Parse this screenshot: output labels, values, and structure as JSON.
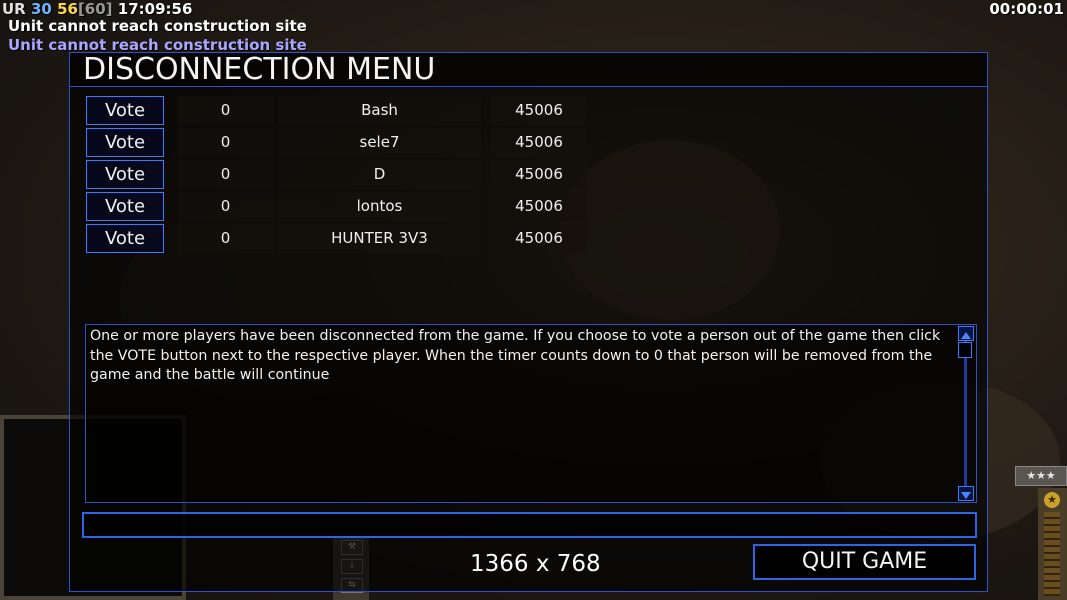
{
  "hud": {
    "ur_label": "UR",
    "stat1": "30",
    "stat2": "56",
    "stat3": "[60]",
    "clock": "17:09:56",
    "timer": "00:00:01"
  },
  "messages": [
    "Unit cannot reach construction site",
    "Unit cannot reach construction site"
  ],
  "dialog": {
    "title": "DISCONNECTION MENU",
    "vote_label": "Vote",
    "players": [
      {
        "count": "0",
        "name": "Bash",
        "port": "45006"
      },
      {
        "count": "0",
        "name": "sele7",
        "port": "45006"
      },
      {
        "count": "0",
        "name": "D",
        "port": "45006"
      },
      {
        "count": "0",
        "name": "lontos",
        "port": "45006"
      },
      {
        "count": "0",
        "name": "HUNTER 3V3",
        "port": "45006"
      }
    ],
    "info_text": "One or more players have been disconnected from the game. If you choose to vote a person out of the game then click the VOTE button next to the respective player. When the timer counts down to 0 that person will be removed from the game and the battle will continue",
    "chat_value": "",
    "resolution": "1366 x 768",
    "quit_label": "QUIT GAME"
  },
  "rank_badge": "★★★",
  "colors": {
    "accent_border": "#2b52c9",
    "button_border": "#3b7bff",
    "hud_blue": "#6fb3ff",
    "hud_yellow": "#ffd84a",
    "message_purple": "#a9a6ff"
  },
  "icons": {
    "scroll_up": "triangle-up-icon",
    "scroll_down": "triangle-down-icon",
    "rank": "star-icon"
  }
}
